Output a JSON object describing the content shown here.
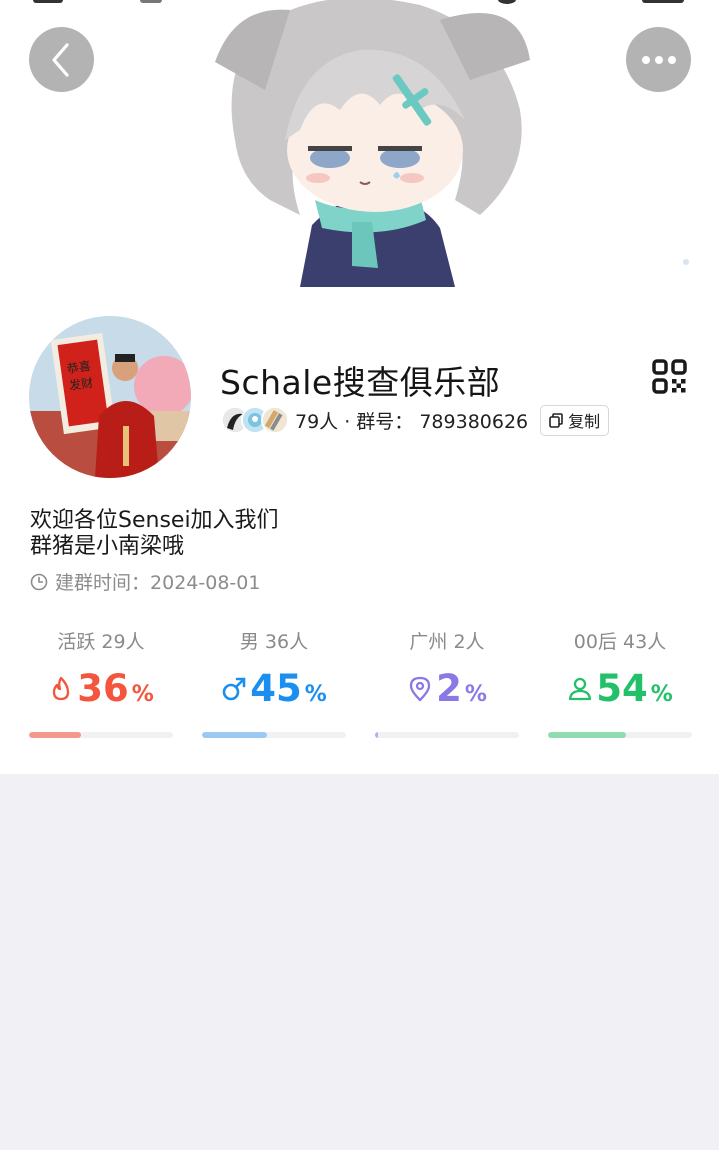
{
  "header": {
    "back_icon": "chevron-left-icon",
    "more_icon": "ellipsis-icon"
  },
  "group": {
    "name": "Schale搜查俱乐部",
    "member_line": "79人 · 群号： 789380626",
    "copy_label": "复制",
    "description_line1": "欢迎各位Sensei加入我们",
    "description_line2": "群猪是小南梁哦",
    "created_label": "建群时间：",
    "created_date": "2024-08-01"
  },
  "stats": [
    {
      "label": "活跃 29人",
      "value": "36",
      "percent_sign": "%",
      "fraction": 0.36,
      "color": "#f4553d",
      "track_color": "#f3988a",
      "icon": "flame-icon"
    },
    {
      "label": "男 36人",
      "value": "45",
      "percent_sign": "%",
      "fraction": 0.45,
      "color": "#1b8ff0",
      "track_color": "#9cc9f4",
      "icon": "male-icon"
    },
    {
      "label": "广州 2人",
      "value": "2",
      "percent_sign": "%",
      "fraction": 0.02,
      "color": "#8b78e6",
      "track_color": "#b9abf0",
      "icon": "location-pin-icon"
    },
    {
      "label": "00后 43人",
      "value": "54",
      "percent_sign": "%",
      "fraction": 0.54,
      "color": "#23c06a",
      "track_color": "#8fdcb0",
      "icon": "person-icon"
    }
  ]
}
